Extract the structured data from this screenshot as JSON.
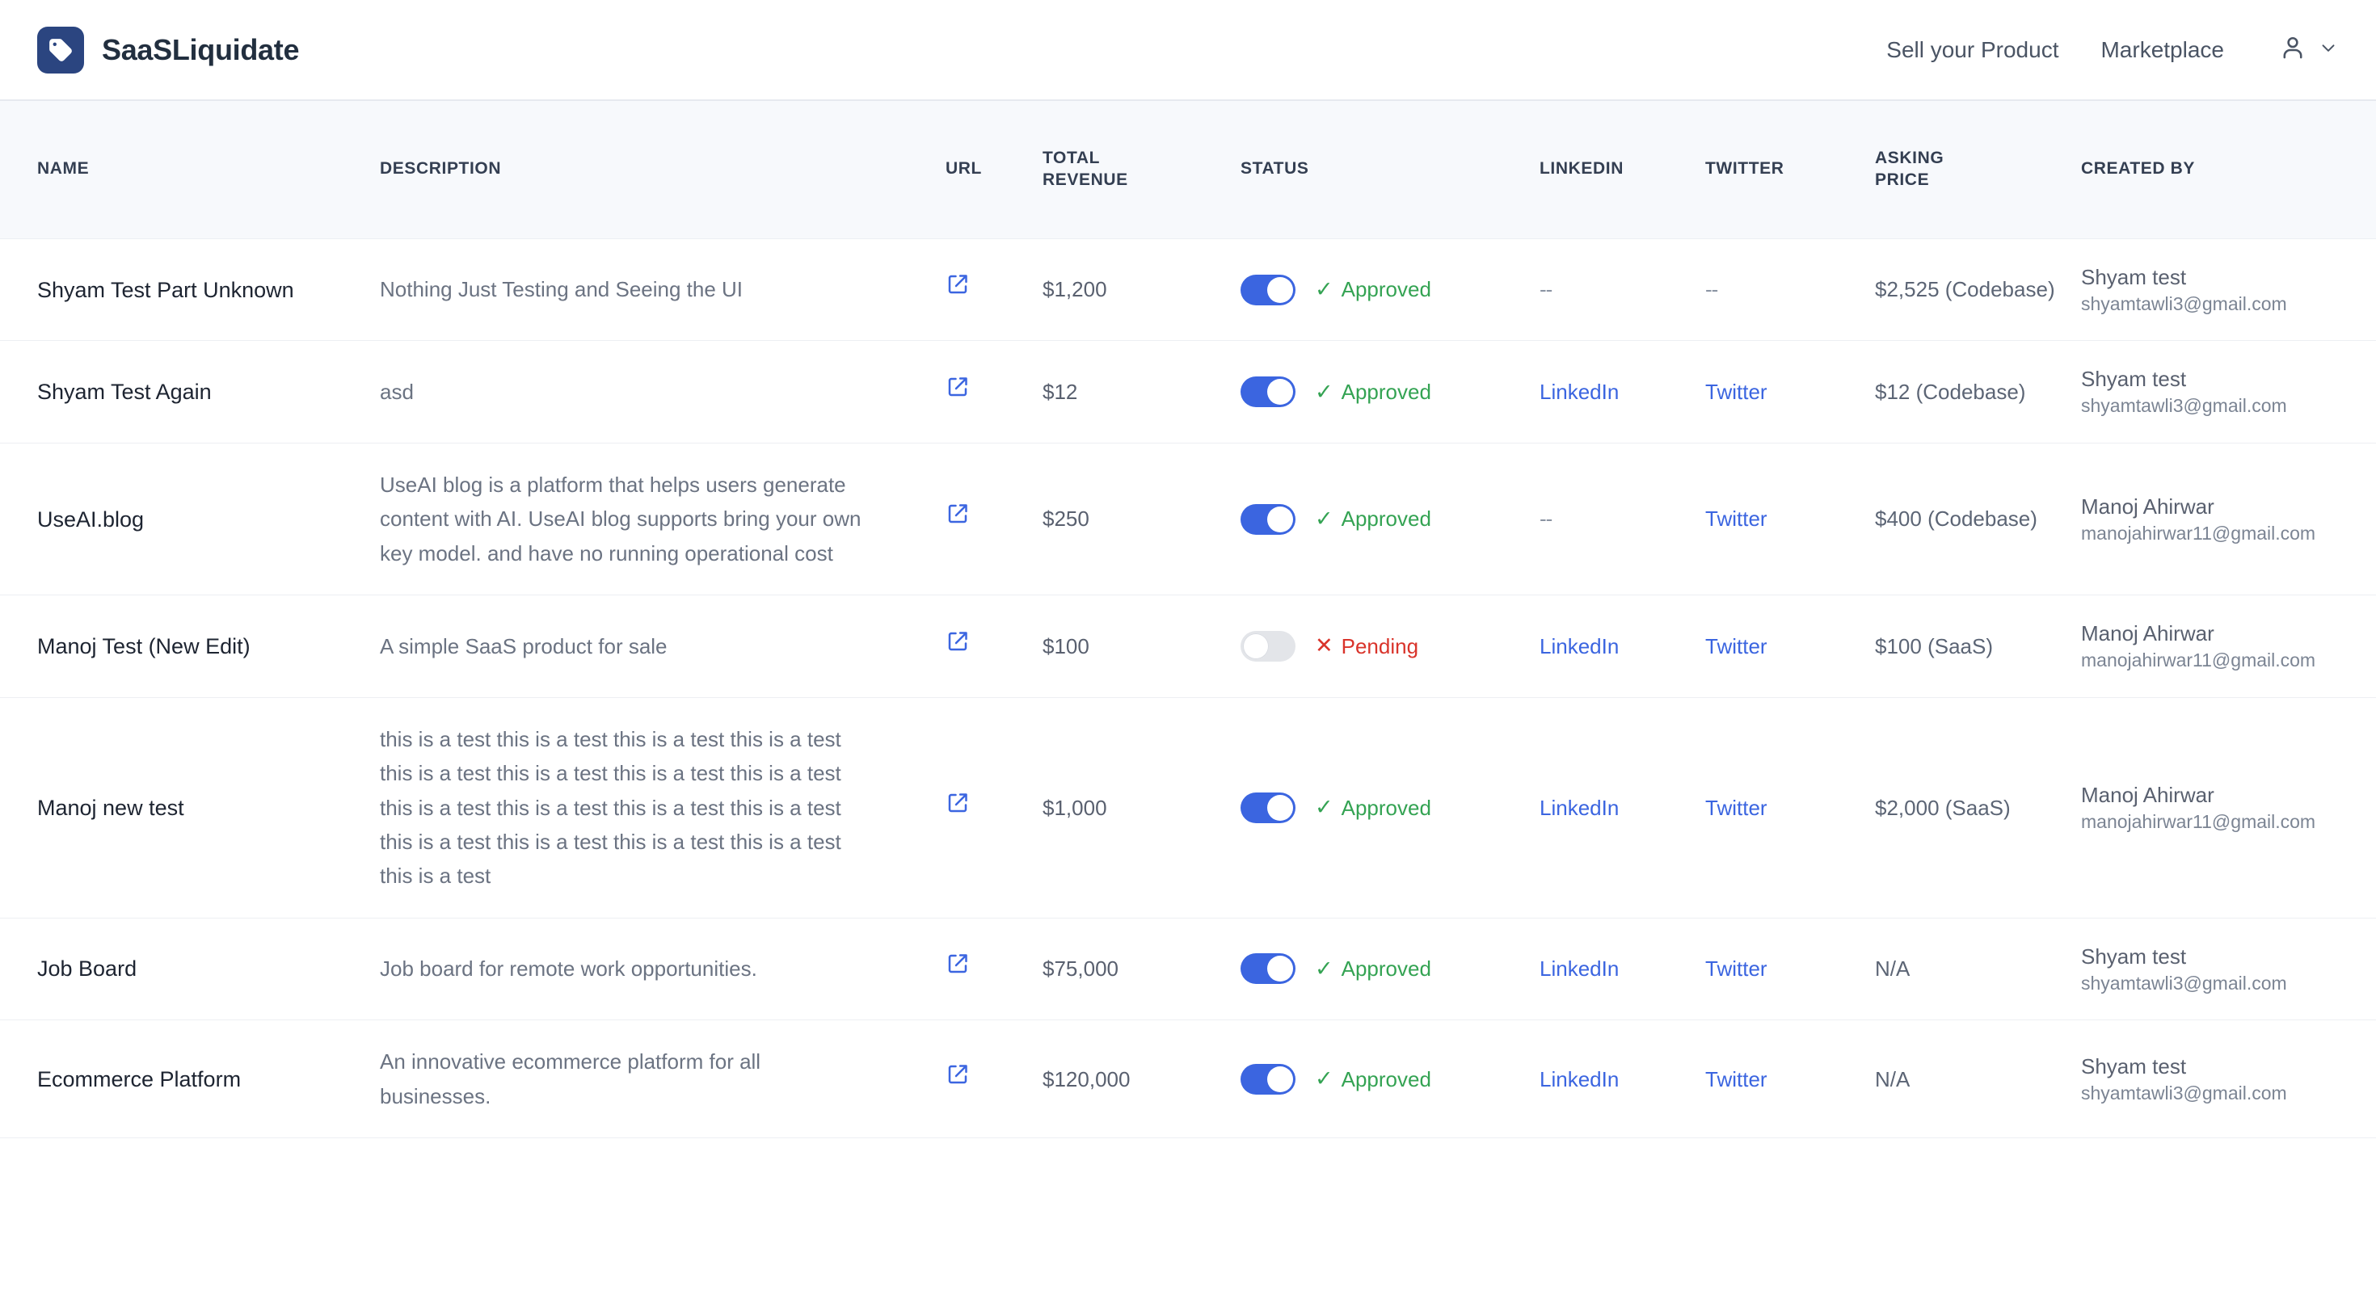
{
  "header": {
    "brand_name": "SaaSLiquidate",
    "brand_icon": "price-tag-icon",
    "nav": [
      {
        "label": "Sell your Product"
      },
      {
        "label": "Marketplace"
      }
    ],
    "account_icon": "user-icon",
    "account_chevron_icon": "chevron-down-icon",
    "brand_color": "#2b4580"
  },
  "table": {
    "columns": [
      {
        "key": "name",
        "label": "NAME"
      },
      {
        "key": "description",
        "label": "DESCRIPTION"
      },
      {
        "key": "url",
        "label": "URL"
      },
      {
        "key": "total_revenue",
        "label": "TOTAL REVENUE"
      },
      {
        "key": "status",
        "label": "STATUS"
      },
      {
        "key": "linkedin",
        "label": "LINKEDIN"
      },
      {
        "key": "twitter",
        "label": "TWITTER"
      },
      {
        "key": "asking_price",
        "label": "ASKING PRICE"
      },
      {
        "key": "created_by",
        "label": "CREATED BY"
      }
    ],
    "rows": [
      {
        "name": "Shyam Test Part Unknown",
        "description": "Nothing Just Testing and Seeing the UI",
        "url_icon": "external-link-icon",
        "total_revenue": "$1,200",
        "status_on": true,
        "status_label": "Approved",
        "status_mark": "✓",
        "linkedin": "--",
        "linkedin_is_link": false,
        "twitter": "--",
        "twitter_is_link": false,
        "asking_price": "$2,525 (Codebase)",
        "created_by_name": "Shyam test",
        "created_by_email": "shyamtawli3@gmail.com"
      },
      {
        "name": "Shyam Test Again",
        "description": "asd",
        "url_icon": "external-link-icon",
        "total_revenue": "$12",
        "status_on": true,
        "status_label": "Approved",
        "status_mark": "✓",
        "linkedin": "LinkedIn",
        "linkedin_is_link": true,
        "twitter": "Twitter",
        "twitter_is_link": true,
        "asking_price": "$12 (Codebase)",
        "created_by_name": "Shyam test",
        "created_by_email": "shyamtawli3@gmail.com"
      },
      {
        "name": "UseAI.blog",
        "description": "UseAI blog is a platform that helps users generate content with AI. UseAI blog supports bring your own key model. and have no running operational cost",
        "url_icon": "external-link-icon",
        "total_revenue": "$250",
        "status_on": true,
        "status_label": "Approved",
        "status_mark": "✓",
        "linkedin": "--",
        "linkedin_is_link": false,
        "twitter": "Twitter",
        "twitter_is_link": true,
        "asking_price": "$400 (Codebase)",
        "created_by_name": "Manoj Ahirwar",
        "created_by_email": "manojahirwar11@gmail.com"
      },
      {
        "name": "Manoj Test (New Edit)",
        "description": "A simple SaaS product for sale",
        "url_icon": "external-link-icon",
        "total_revenue": "$100",
        "status_on": false,
        "status_label": "Pending",
        "status_mark": "✕",
        "linkedin": "LinkedIn",
        "linkedin_is_link": true,
        "twitter": "Twitter",
        "twitter_is_link": true,
        "asking_price": "$100 (SaaS)",
        "created_by_name": "Manoj Ahirwar",
        "created_by_email": "manojahirwar11@gmail.com"
      },
      {
        "name": "Manoj new test",
        "description": "this is a test this is a test this is a test this is a test this is a test this is a test this is a test this is a test this is a test this is a test this is a test this is a test this is a test this is a test this is a test this is a test this is a test",
        "url_icon": "external-link-icon",
        "total_revenue": "$1,000",
        "status_on": true,
        "status_label": "Approved",
        "status_mark": "✓",
        "linkedin": "LinkedIn",
        "linkedin_is_link": true,
        "twitter": "Twitter",
        "twitter_is_link": true,
        "asking_price": "$2,000 (SaaS)",
        "created_by_name": "Manoj Ahirwar",
        "created_by_email": "manojahirwar11@gmail.com"
      },
      {
        "name": "Job Board",
        "description": "Job board for remote work opportunities.",
        "url_icon": "external-link-icon",
        "total_revenue": "$75,000",
        "status_on": true,
        "status_label": "Approved",
        "status_mark": "✓",
        "linkedin": "LinkedIn",
        "linkedin_is_link": true,
        "twitter": "Twitter",
        "twitter_is_link": true,
        "asking_price": "N/A",
        "created_by_name": "Shyam test",
        "created_by_email": "shyamtawli3@gmail.com"
      },
      {
        "name": "Ecommerce Platform",
        "description": "An innovative ecommerce platform for all businesses.",
        "url_icon": "external-link-icon",
        "total_revenue": "$120,000",
        "status_on": true,
        "status_label": "Approved",
        "status_mark": "✓",
        "linkedin": "LinkedIn",
        "linkedin_is_link": true,
        "twitter": "Twitter",
        "twitter_is_link": true,
        "asking_price": "N/A",
        "created_by_name": "Shyam test",
        "created_by_email": "shyamtawli3@gmail.com"
      }
    ]
  },
  "colors": {
    "toggle_on": "#3b65e0",
    "toggle_off": "#e3e5e9",
    "approved": "#34a353",
    "pending": "#d9342b",
    "link": "#3b65e0",
    "header_bg": "#f7f9fc"
  }
}
